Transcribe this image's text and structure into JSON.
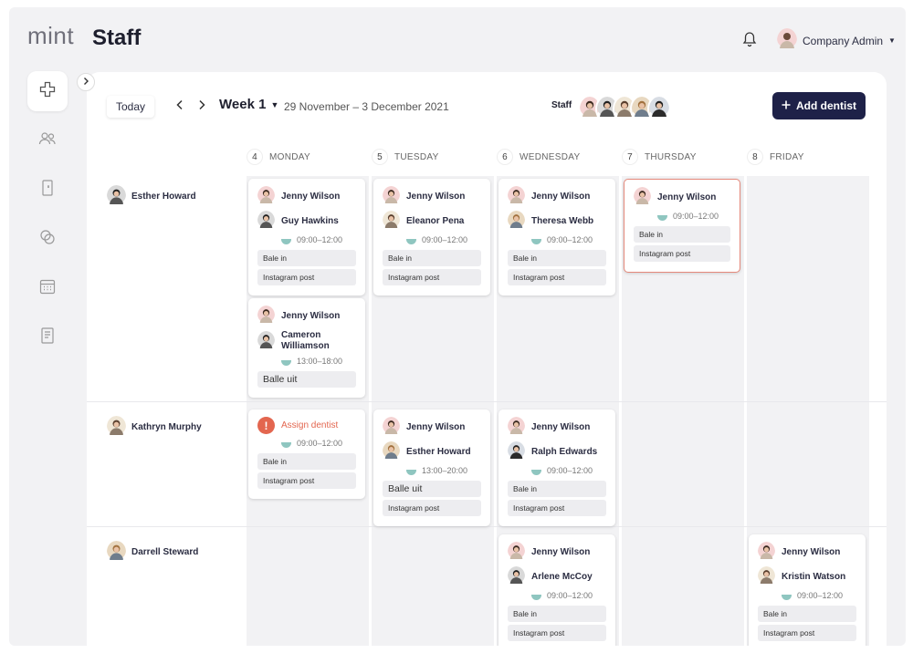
{
  "app": {
    "logo": "mint",
    "page_title": "Staff"
  },
  "header": {
    "user_name": "Company Admin",
    "notification_icon": "bell-icon"
  },
  "sidebar": {
    "items": [
      {
        "icon": "plus-icon",
        "active": true
      },
      {
        "icon": "users-icon",
        "active": false
      },
      {
        "icon": "door-icon",
        "active": false
      },
      {
        "icon": "rings-icon",
        "active": false
      },
      {
        "icon": "calendar-icon",
        "active": false
      },
      {
        "icon": "document-icon",
        "active": false
      }
    ]
  },
  "toolbar": {
    "today_label": "Today",
    "week_label": "Week 1",
    "date_range": "29 November – 3 December 2021",
    "staff_label": "Staff",
    "add_label": "Add dentist"
  },
  "days": [
    {
      "num": "4",
      "name": "MONDAY"
    },
    {
      "num": "5",
      "name": "TUESDAY"
    },
    {
      "num": "6",
      "name": "WEDNESDAY"
    },
    {
      "num": "7",
      "name": "THURSDAY"
    },
    {
      "num": "8",
      "name": "FRIDAY"
    }
  ],
  "staff_rows": [
    "Esther Howard",
    "Kathryn Murphy",
    "Darrell Steward"
  ],
  "cards": [
    {
      "row": 0,
      "day": 0,
      "slot": 0,
      "assistant": "Jenny Wilson",
      "dentist": "Guy Hawkins",
      "time": "09:00–12:00",
      "tags": [
        "Bale in",
        "Instagram post"
      ]
    },
    {
      "row": 0,
      "day": 1,
      "slot": 0,
      "assistant": "Jenny Wilson",
      "dentist": "Eleanor Pena",
      "time": "09:00–12:00",
      "tags": [
        "Bale in",
        "Instagram post"
      ]
    },
    {
      "row": 0,
      "day": 2,
      "slot": 0,
      "assistant": "Jenny Wilson",
      "dentist": "Theresa Webb",
      "time": "09:00–12:00",
      "tags": [
        "Bale in",
        "Instagram post"
      ]
    },
    {
      "row": 0,
      "day": 3,
      "slot": 0,
      "assistant": "Jenny Wilson",
      "time": "09:00–12:00",
      "tags": [
        "Bale in",
        "Instagram post"
      ],
      "highlight": true
    },
    {
      "row": 0,
      "day": 0,
      "slot": 1,
      "assistant": "Jenny Wilson",
      "dentist": "Cameron Williamson",
      "time": "13:00–18:00",
      "tags": [
        "Balle uit"
      ]
    },
    {
      "row": 1,
      "day": 0,
      "slot": 0,
      "warning": "Assign dentist",
      "time": "09:00–12:00",
      "tags": [
        "Bale in",
        "Instagram post"
      ]
    },
    {
      "row": 1,
      "day": 1,
      "slot": 0,
      "assistant": "Jenny Wilson",
      "dentist": "Esther Howard",
      "time": "13:00–20:00",
      "tags": [
        "Balle uit",
        "Instagram post"
      ]
    },
    {
      "row": 1,
      "day": 2,
      "slot": 0,
      "assistant": "Jenny Wilson",
      "dentist": "Ralph Edwards",
      "time": "09:00–12:00",
      "tags": [
        "Bale in",
        "Instagram post"
      ]
    },
    {
      "row": 2,
      "day": 2,
      "slot": 0,
      "assistant": "Jenny Wilson",
      "dentist": "Arlene McCoy",
      "time": "09:00–12:00",
      "tags": [
        "Bale in",
        "Instagram post"
      ]
    },
    {
      "row": 2,
      "day": 4,
      "slot": 0,
      "assistant": "Jenny Wilson",
      "dentist": "Kristin Watson",
      "time": "09:00–12:00",
      "tags": [
        "Bale in",
        "Instagram post"
      ]
    }
  ],
  "colors": {
    "primary": "#1e2148",
    "alert": "#e3664f",
    "time_dot": "#8fc6c0"
  }
}
